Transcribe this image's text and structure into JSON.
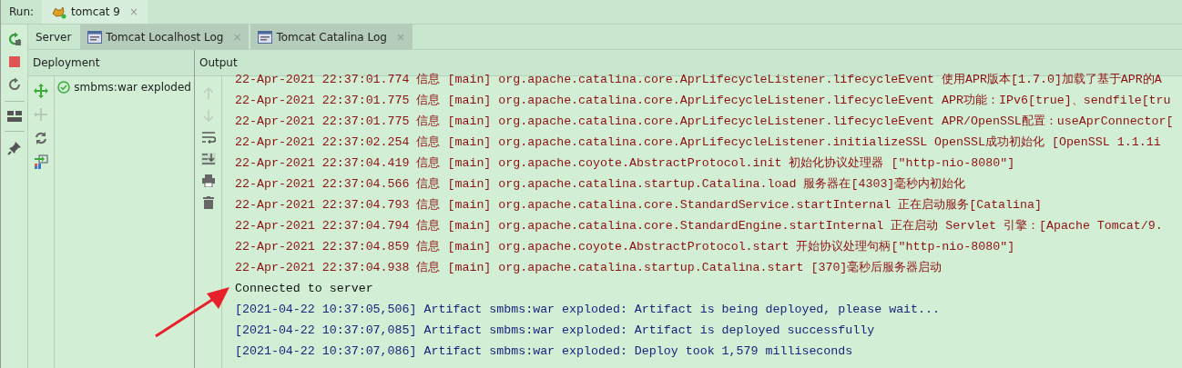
{
  "run_bar": {
    "label": "Run:",
    "tabs": [
      {
        "label": "tomcat 9",
        "close": "×",
        "selected": true
      }
    ]
  },
  "tabs": [
    {
      "label": "Server",
      "selected": true
    },
    {
      "label": "Tomcat Localhost Log",
      "close": "×",
      "selected": false
    },
    {
      "label": "Tomcat Catalina Log",
      "close": "×",
      "selected": false
    }
  ],
  "deployment": {
    "title": "Deployment",
    "items": [
      {
        "label": "smbms:war exploded",
        "deployed": true
      }
    ]
  },
  "output": {
    "title": "Output",
    "lines": [
      {
        "kind": "stderr",
        "text": "22-Apr-2021 22:37:01.774 信息 [main] org.apache.catalina.core.AprLifecycleListener.lifecycleEvent 使用APR版本[1.7.0]加载了基于APR的A"
      },
      {
        "kind": "stderr",
        "text": "22-Apr-2021 22:37:01.775 信息 [main] org.apache.catalina.core.AprLifecycleListener.lifecycleEvent APR功能：IPv6[true]、sendfile[tru"
      },
      {
        "kind": "stderr",
        "text": "22-Apr-2021 22:37:01.775 信息 [main] org.apache.catalina.core.AprLifecycleListener.lifecycleEvent APR/OpenSSL配置：useAprConnector["
      },
      {
        "kind": "stderr",
        "text": "22-Apr-2021 22:37:02.254 信息 [main] org.apache.catalina.core.AprLifecycleListener.initializeSSL OpenSSL成功初始化 [OpenSSL 1.1.1i"
      },
      {
        "kind": "stderr",
        "text": "22-Apr-2021 22:37:04.419 信息 [main] org.apache.coyote.AbstractProtocol.init 初始化协议处理器 [\"http-nio-8080\"]"
      },
      {
        "kind": "stderr",
        "text": "22-Apr-2021 22:37:04.566 信息 [main] org.apache.catalina.startup.Catalina.load 服务器在[4303]毫秒内初始化"
      },
      {
        "kind": "stderr",
        "text": "22-Apr-2021 22:37:04.793 信息 [main] org.apache.catalina.core.StandardService.startInternal 正在启动服务[Catalina]"
      },
      {
        "kind": "stderr",
        "text": "22-Apr-2021 22:37:04.794 信息 [main] org.apache.catalina.core.StandardEngine.startInternal 正在启动 Servlet 引擎：[Apache Tomcat/9."
      },
      {
        "kind": "stderr",
        "text": "22-Apr-2021 22:37:04.859 信息 [main] org.apache.coyote.AbstractProtocol.start 开始协议处理句柄[\"http-nio-8080\"]"
      },
      {
        "kind": "stderr",
        "text": "22-Apr-2021 22:37:04.938 信息 [main] org.apache.catalina.startup.Catalina.start [370]毫秒后服务器启动"
      },
      {
        "kind": "system",
        "text": "Connected to server"
      },
      {
        "kind": "stdout",
        "text": "[2021-04-22 10:37:05,506] Artifact smbms:war exploded: Artifact is being deployed, please wait..."
      },
      {
        "kind": "stdout",
        "text": "[2021-04-22 10:37:07,085] Artifact smbms:war exploded: Artifact is deployed successfully"
      },
      {
        "kind": "stdout",
        "text": "[2021-04-22 10:37:07,086] Artifact smbms:war exploded: Deploy took 1,579 milliseconds"
      }
    ]
  }
}
